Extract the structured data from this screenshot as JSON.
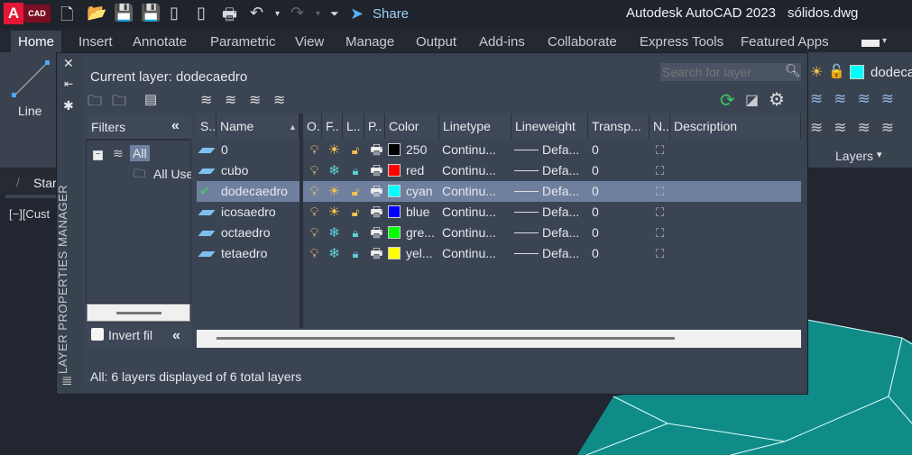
{
  "app": {
    "title": "Autodesk AutoCAD 2023",
    "file": "sólidos.dwg",
    "logo_text": "CAD",
    "share_label": "Share"
  },
  "ribbon_tabs": [
    "Home",
    "Insert",
    "Annotate",
    "Parametric",
    "View",
    "Manage",
    "Output",
    "Add-ins",
    "Collaborate",
    "Express Tools",
    "Featured Apps"
  ],
  "ribbon": {
    "line_label": "Line",
    "layers_label": "Layers",
    "current_layer_short": "dodeca",
    "start_tab": "Star",
    "viewport_label": "[−][Cust"
  },
  "palette": {
    "side_title": "LAYER PROPERTIES MANAGER",
    "current_layer": "Current layer: dodecaedro",
    "search_placeholder": "Search for layer",
    "filters_title": "Filters",
    "filter_tree": [
      "All",
      "All Use"
    ],
    "invert_filter": "Invert fil",
    "status": "All: 6 layers displayed of 6 total layers",
    "columns": [
      "S..",
      "Name",
      "O..",
      "F..",
      "L..",
      "P..",
      "Color",
      "Linetype",
      "Lineweight",
      "Transp...",
      "N..",
      "Description"
    ],
    "layers": [
      {
        "name": "0",
        "current": false,
        "frozen": false,
        "locked": false,
        "color": "250",
        "hex": "#000000",
        "linetype": "Continu...",
        "lineweight": "Defa...",
        "transparency": "0"
      },
      {
        "name": "cubo",
        "current": false,
        "frozen": true,
        "locked": true,
        "color": "red",
        "hex": "#ff0000",
        "linetype": "Continu...",
        "lineweight": "Defa...",
        "transparency": "0"
      },
      {
        "name": "dodecaedro",
        "current": true,
        "frozen": false,
        "locked": false,
        "color": "cyan",
        "hex": "#00ffff",
        "linetype": "Continu...",
        "lineweight": "Defa...",
        "transparency": "0"
      },
      {
        "name": "icosaedro",
        "current": false,
        "frozen": false,
        "locked": false,
        "color": "blue",
        "hex": "#0000ff",
        "linetype": "Continu...",
        "lineweight": "Defa...",
        "transparency": "0"
      },
      {
        "name": "octaedro",
        "current": false,
        "frozen": true,
        "locked": true,
        "color": "gre...",
        "hex": "#00ff00",
        "linetype": "Continu...",
        "lineweight": "Defa...",
        "transparency": "0"
      },
      {
        "name": "tetaedro",
        "current": false,
        "frozen": true,
        "locked": true,
        "color": "yel...",
        "hex": "#ffff00",
        "linetype": "Continu...",
        "lineweight": "Defa...",
        "transparency": "0"
      }
    ]
  },
  "colors": {
    "accent_red": "#c8102e",
    "selection": "#6f809e",
    "solid": "#0f8c88"
  }
}
